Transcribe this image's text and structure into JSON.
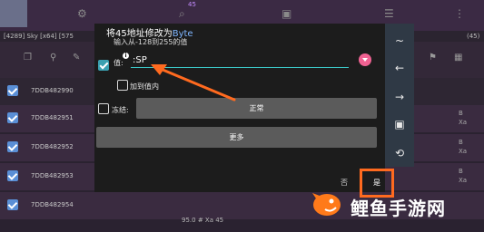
{
  "background": {
    "badge_count": "45",
    "process_info": "[4289] Sky [x64] [575",
    "results_count": "(45)",
    "footer_value": "95.0",
    "footer_hint": "# Xa 45",
    "rows": [
      {
        "address": "7DDB482990",
        "side": "B\nXa"
      },
      {
        "address": "7DDB482951",
        "side": "B\nXa"
      },
      {
        "address": "7DDB482952",
        "side": "B\nXa"
      },
      {
        "address": "7DDB482953",
        "side": "B\nXa"
      },
      {
        "address": "7DDB482954",
        "side": "B\nXa"
      }
    ]
  },
  "dialog": {
    "title_prefix": "将45地址修改为",
    "title_type": "Byte",
    "subtitle": "输入从-128到255的值",
    "value_label": "值:",
    "value_input": ":SP",
    "add_to_value_label": "加到值内",
    "freeze_label": "冻结:",
    "normal_button": "正常",
    "more_button": "更多",
    "cancel_button": "否",
    "ok_button": "是"
  },
  "side_panel": {
    "icons": [
      "tilde-icon",
      "arrow-left-icon",
      "arrow-right-icon",
      "select-icon",
      "history-icon"
    ],
    "glyphs": [
      "~",
      "←",
      "→",
      "▣",
      "⟲"
    ]
  },
  "watermark": {
    "text": "鲤鱼手游网"
  },
  "colors": {
    "accent_cyan": "#3cc8c8",
    "highlight_orange": "#ff6a1f",
    "history_pink": "#f06292"
  }
}
